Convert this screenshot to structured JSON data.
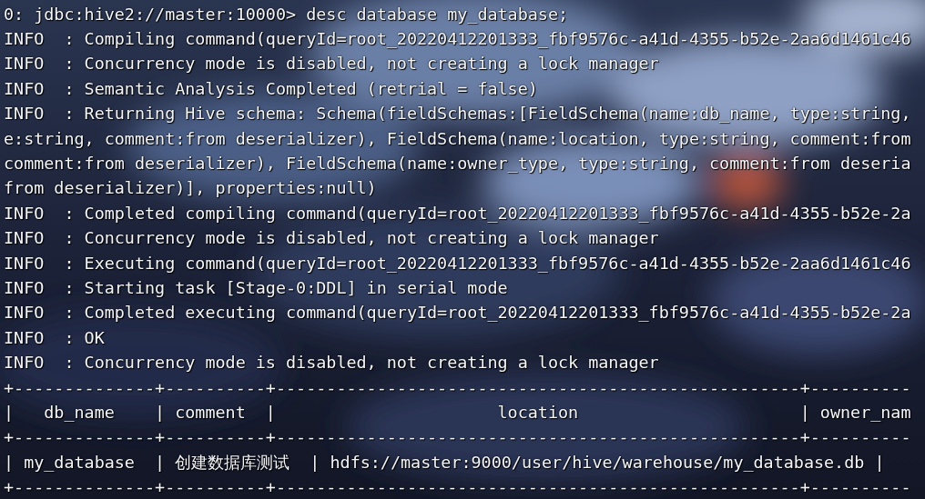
{
  "terminal": {
    "lines": [
      "0: jdbc:hive2://master:10000> desc database my_database;",
      "INFO  : Compiling command(queryId=root_20220412201333_fbf9576c-a41d-4355-b52e-2aa6d1461c46",
      "INFO  : Concurrency mode is disabled, not creating a lock manager",
      "INFO  : Semantic Analysis Completed (retrial = false)",
      "INFO  : Returning Hive schema: Schema(fieldSchemas:[FieldSchema(name:db_name, type:string,",
      "e:string, comment:from deserializer), FieldSchema(name:location, type:string, comment:from",
      "comment:from deserializer), FieldSchema(name:owner_type, type:string, comment:from deseria",
      "from deserializer)], properties:null)",
      "INFO  : Completed compiling command(queryId=root_20220412201333_fbf9576c-a41d-4355-b52e-2a",
      "INFO  : Concurrency mode is disabled, not creating a lock manager",
      "INFO  : Executing command(queryId=root_20220412201333_fbf9576c-a41d-4355-b52e-2aa6d1461c46",
      "INFO  : Starting task [Stage-0:DDL] in serial mode",
      "INFO  : Completed executing command(queryId=root_20220412201333_fbf9576c-a41d-4355-b52e-2a",
      "INFO  : OK",
      "INFO  : Concurrency mode is disabled, not creating a lock manager",
      "+--------------+----------+----------------------------------------------------+----------",
      "|   db_name    | comment  |                      location                      | owner_nam",
      "+--------------+----------+----------------------------------------------------+----------",
      "| my_database  | 创建数据库测试  | hdfs://master:9000/user/hive/warehouse/my_database.db |",
      "+--------------+----------+----------------------------------------------------+----------"
    ]
  }
}
